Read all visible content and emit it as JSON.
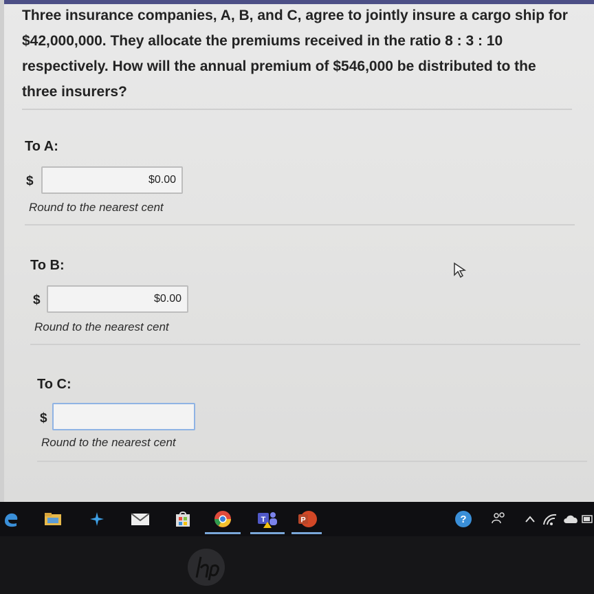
{
  "question": {
    "text": "Three insurance companies, A, B, and C, agree to jointly insure a cargo ship for $42,000,000. They allocate the premiums received in the ratio 8 : 3 : 10 respectively. How will the annual premium of $546,000 be distributed to the three insurers?"
  },
  "answers": [
    {
      "label": "To A:",
      "currency": "$",
      "value": "$0.00",
      "hint": "Round to the nearest cent"
    },
    {
      "label": "To B:",
      "currency": "$",
      "value": "$0.00",
      "hint": "Round to the nearest cent"
    },
    {
      "label": "To C:",
      "currency": "$",
      "value": "",
      "hint": "Round to the nearest cent"
    }
  ],
  "taskbar": {
    "icons": [
      "edge-icon",
      "file-explorer-icon",
      "sparkle-app-icon",
      "mail-icon",
      "store-icon",
      "chrome-icon",
      "teams-icon",
      "powerpoint-icon",
      "help-icon",
      "people-icon",
      "chevron-up-icon",
      "wifi-icon",
      "cloud-icon",
      "battery-icon"
    ]
  },
  "colors": {
    "accent": "#4c4f86",
    "focus": "#8fb3e4"
  }
}
